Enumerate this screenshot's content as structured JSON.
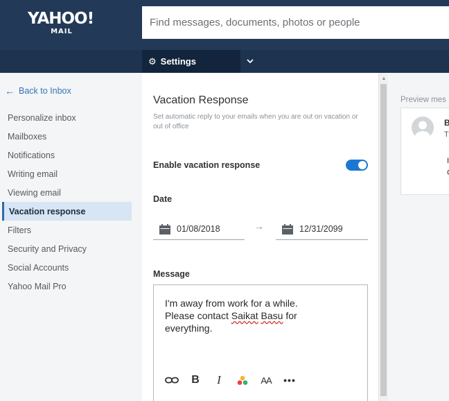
{
  "header": {
    "logo_main": "YAHOO!",
    "logo_sub": "MAIL",
    "search_placeholder": "Find messages, documents, photos or people"
  },
  "subbar": {
    "settings_label": "Settings"
  },
  "sidebar": {
    "back_label": "Back to Inbox",
    "items": [
      {
        "label": "Personalize inbox",
        "active": false
      },
      {
        "label": "Mailboxes",
        "active": false
      },
      {
        "label": "Notifications",
        "active": false
      },
      {
        "label": "Writing email",
        "active": false
      },
      {
        "label": "Viewing email",
        "active": false
      },
      {
        "label": "Vacation response",
        "active": true
      },
      {
        "label": "Filters",
        "active": false
      },
      {
        "label": "Security and Privacy",
        "active": false
      },
      {
        "label": "Social Accounts",
        "active": false
      },
      {
        "label": "Yahoo Mail Pro",
        "active": false
      }
    ]
  },
  "vacation": {
    "title": "Vacation Response",
    "description": "Set automatic reply to your emails when you are out on vacation or out of office",
    "enable_label": "Enable vacation response",
    "enabled": true,
    "date_label": "Date",
    "start_date": "01/08/2018",
    "end_date": "12/31/2099",
    "message_label": "Message",
    "message_line1": "I'm away from work for a while.",
    "message_line2_prefix": "Please contact",
    "message_name_first": "Saikat",
    "message_name_last": "Basu",
    "message_line2_suffix": "for",
    "message_line3": "everything."
  },
  "preview": {
    "label": "Preview mes",
    "sender_initial": "B",
    "to_initial": "T",
    "line1_initial": "I",
    "line2_initial": "C"
  },
  "colors": {
    "header_bg": "#223a58",
    "subbar_bg": "#1d3350",
    "accent": "#1a78d3",
    "link": "#3373b6",
    "active_nav_bg": "#d7e5f4"
  }
}
